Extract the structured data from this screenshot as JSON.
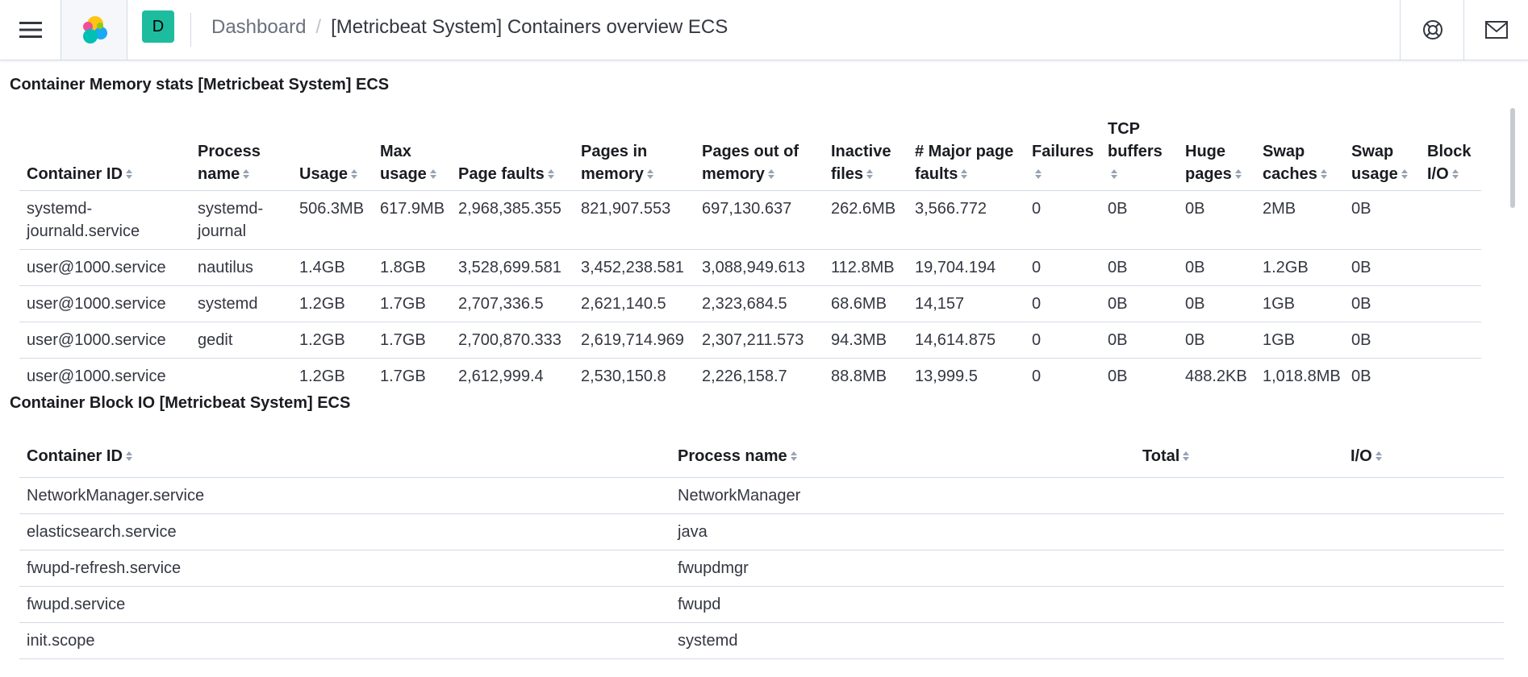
{
  "header": {
    "menu_icon": "hamburger-menu-icon",
    "logo_icon": "elastic-logo-icon",
    "space_avatar": "D",
    "breadcrumb_parent": "Dashboard",
    "breadcrumb_separator": "/",
    "breadcrumb_current": "[Metricbeat System] Containers overview ECS",
    "help_icon": "help-lifebuoy-icon",
    "news_icon": "mail-icon",
    "accent_color": "#1ebc9f"
  },
  "memory_panel": {
    "title": "Container Memory stats [Metricbeat System] ECS",
    "columns": [
      {
        "label": "Container ID"
      },
      {
        "label": "Process name"
      },
      {
        "label": "Usage"
      },
      {
        "label": "Max usage"
      },
      {
        "label": "Page faults"
      },
      {
        "label": "Pages in memory"
      },
      {
        "label": "Pages out of memory"
      },
      {
        "label": "Inactive files"
      },
      {
        "label": "# Major page faults"
      },
      {
        "label": "Failures"
      },
      {
        "label": "TCP buffers"
      },
      {
        "label": "Huge pages"
      },
      {
        "label": "Swap caches"
      },
      {
        "label": "Swap usage"
      },
      {
        "label": "Block I/O"
      }
    ],
    "rows": [
      [
        "systemd-journald.service",
        "systemd-journal",
        "506.3MB",
        "617.9MB",
        "2,968,385.355",
        "821,907.553",
        "697,130.637",
        "262.6MB",
        "3,566.772",
        "0",
        "0B",
        "0B",
        "2MB",
        "0B",
        ""
      ],
      [
        "user@1000.service",
        "nautilus",
        "1.4GB",
        "1.8GB",
        "3,528,699.581",
        "3,452,238.581",
        "3,088,949.613",
        "112.8MB",
        "19,704.194",
        "0",
        "0B",
        "0B",
        "1.2GB",
        "0B",
        ""
      ],
      [
        "user@1000.service",
        "systemd",
        "1.2GB",
        "1.7GB",
        "2,707,336.5",
        "2,621,140.5",
        "2,323,684.5",
        "68.6MB",
        "14,157",
        "0",
        "0B",
        "0B",
        "1GB",
        "0B",
        ""
      ],
      [
        "user@1000.service",
        "gedit",
        "1.2GB",
        "1.7GB",
        "2,700,870.333",
        "2,619,714.969",
        "2,307,211.573",
        "94.3MB",
        "14,614.875",
        "0",
        "0B",
        "0B",
        "1GB",
        "0B",
        ""
      ],
      [
        "user@1000.service",
        "",
        "1.2GB",
        "1.7GB",
        "2,612,999.4",
        "2,530,150.8",
        "2,226,158.7",
        "88.8MB",
        "13,999.5",
        "0",
        "0B",
        "488.2KB",
        "1,018.8MB",
        "0B",
        ""
      ]
    ]
  },
  "block_panel": {
    "title": "Container Block IO [Metricbeat System] ECS",
    "columns": [
      {
        "label": "Container ID"
      },
      {
        "label": "Process name"
      },
      {
        "label": "Total"
      },
      {
        "label": "I/O"
      }
    ],
    "rows": [
      [
        "NetworkManager.service",
        "NetworkManager",
        "",
        ""
      ],
      [
        "elasticsearch.service",
        "java",
        "",
        ""
      ],
      [
        "fwupd-refresh.service",
        "fwupdmgr",
        "",
        ""
      ],
      [
        "fwupd.service",
        "fwupd",
        "",
        ""
      ],
      [
        "init.scope",
        "systemd",
        "",
        ""
      ]
    ]
  }
}
